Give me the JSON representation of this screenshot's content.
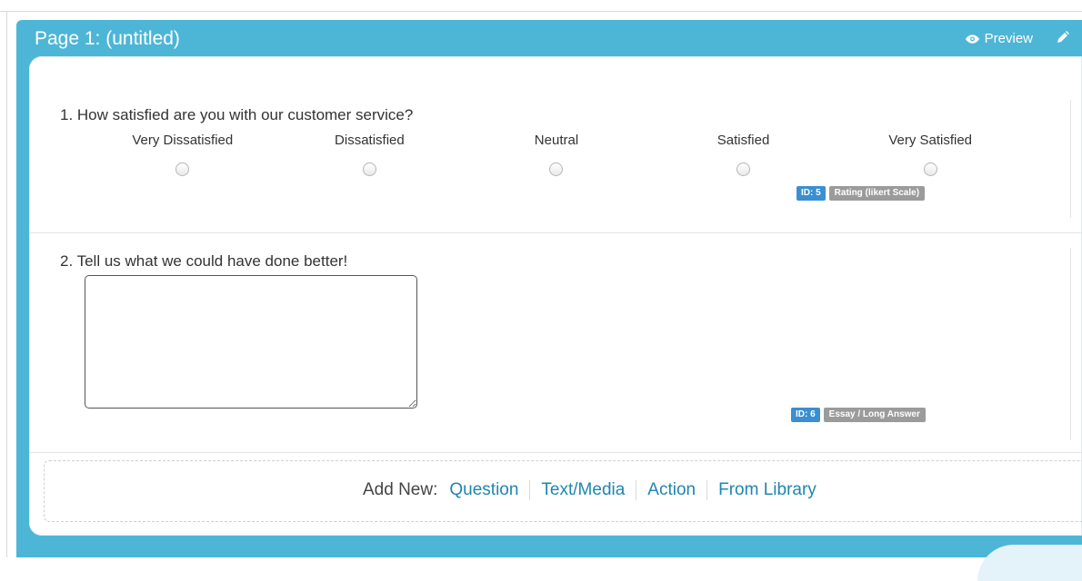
{
  "page": {
    "title": "Page 1: (untitled)",
    "preview_label": "Preview",
    "preview_icon": "eye-icon",
    "edit_icon": "pencil-icon"
  },
  "questions": [
    {
      "text": "1. How satisfied are you with our customer service?",
      "options": [
        "Very Dissatisfied",
        "Dissatisfied",
        "Neutral",
        "Satisfied",
        "Very Satisfied"
      ],
      "id_label": "ID: 5",
      "type_label": "Rating (likert Scale)"
    },
    {
      "text": "2. Tell us what we could have done better!",
      "id_label": "ID: 6",
      "type_label": "Essay / Long Answer"
    }
  ],
  "add_new": {
    "label": "Add New:",
    "links": [
      "Question",
      "Text/Media",
      "Action",
      "From Library"
    ]
  },
  "colors": {
    "header": "#4db6d6",
    "link": "#1f86b0",
    "id_badge": "#3a8fd1",
    "type_badge": "#9b9b9b"
  }
}
